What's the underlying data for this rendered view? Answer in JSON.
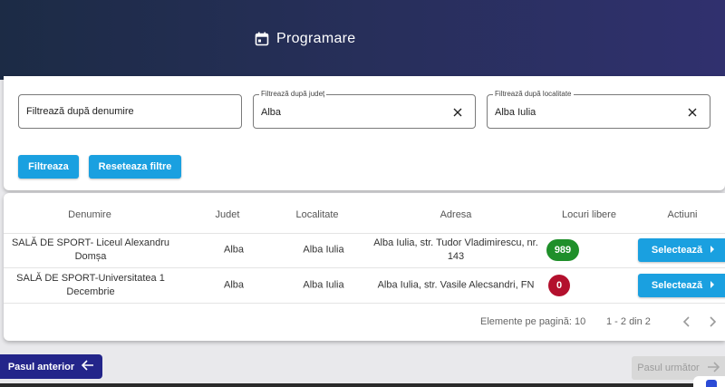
{
  "header": {
    "title": "Programare",
    "icon": "calendar-icon"
  },
  "filters": {
    "name": {
      "placeholder": "Filtrează după denumire",
      "value": ""
    },
    "county": {
      "label": "Filtrează după județ",
      "value": "Alba"
    },
    "locality": {
      "label": "Filtrează după localitate",
      "value": "Alba Iulia"
    },
    "filter_button": "Filtreaza",
    "reset_button": "Reseteaza filtre"
  },
  "table": {
    "columns": [
      "Denumire",
      "Judet",
      "Localitate",
      "Adresa",
      "Locuri libere",
      "Actiuni"
    ],
    "rows": [
      {
        "name_line1": "SALĂ DE SPORT- Liceul Alexandru",
        "name_line2": "Domșa",
        "county": "Alba",
        "locality": "Alba Iulia",
        "address_line1": "Alba Iulia, str. Tudor Vladimirescu, nr.",
        "address_line2": "143",
        "free_spots": "989",
        "badge_color": "#1f8f2a",
        "action": "Selectează"
      },
      {
        "name_line1": "SALĂ DE SPORT-Universitatea 1",
        "name_line2": "Decembrie",
        "county": "Alba",
        "locality": "Alba Iulia",
        "address_line1": "Alba Iulia, str. Vasile Alecsandri, FN",
        "address_line2": "",
        "free_spots": "0",
        "badge_color": "#b3102d",
        "action": "Selectează"
      }
    ],
    "pagination": {
      "per_page_label": "Elemente pe pagină: 10",
      "range": "1 - 2 din 2"
    }
  },
  "navigation": {
    "prev": "Pasul anterior",
    "next": "Pasul următor"
  },
  "colors": {
    "accent": "#1aa0e0",
    "primary_dark": "#23258a",
    "success": "#1f8f2a",
    "danger": "#b3102d"
  }
}
